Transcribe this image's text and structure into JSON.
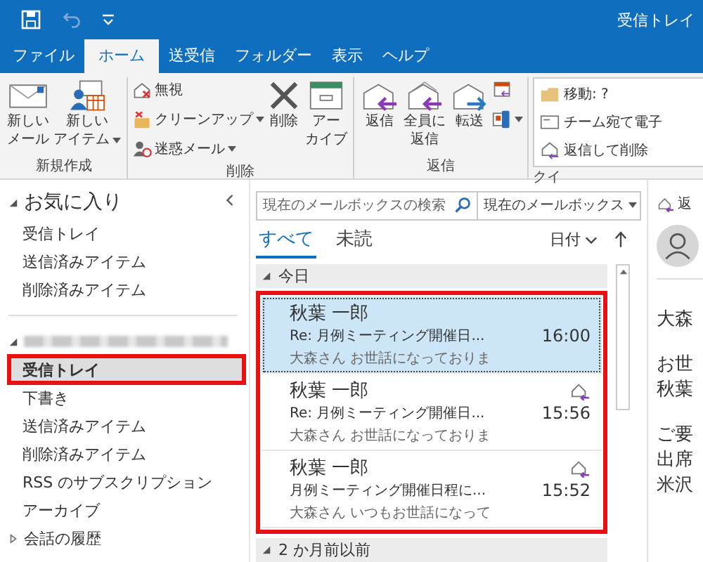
{
  "title_bar": {
    "title": "受信トレイ"
  },
  "ribbon_tabs": [
    {
      "label": "ファイル",
      "selected": false
    },
    {
      "label": "ホーム",
      "selected": true
    },
    {
      "label": "送受信",
      "selected": false
    },
    {
      "label": "フォルダー",
      "selected": false
    },
    {
      "label": "表示",
      "selected": false
    },
    {
      "label": "ヘルプ",
      "selected": false
    }
  ],
  "ribbon_groups": [
    {
      "label": "新規作成",
      "items": [
        {
          "kind": "large",
          "lines": [
            "新しい",
            "メール"
          ],
          "dropdown": false
        },
        {
          "kind": "large",
          "lines": [
            "新しい",
            "アイテム"
          ],
          "dropdown": true
        }
      ]
    },
    {
      "label": "削除",
      "items": [
        {
          "kind": "stack",
          "entries": [
            {
              "label": "無視",
              "dropdown": false
            },
            {
              "label": "クリーンアップ",
              "dropdown": true
            },
            {
              "label": "迷惑メール",
              "dropdown": true
            }
          ]
        },
        {
          "kind": "large",
          "lines": [
            "削除"
          ],
          "dropdown": false
        },
        {
          "kind": "large",
          "lines": [
            "アー",
            "カイブ"
          ],
          "dropdown": false
        }
      ]
    },
    {
      "label": "返信",
      "items": [
        {
          "kind": "large",
          "lines": [
            "返信"
          ],
          "dropdown": false
        },
        {
          "kind": "large",
          "lines": [
            "全員に",
            "返信"
          ],
          "dropdown": false
        },
        {
          "kind": "large",
          "lines": [
            "転送"
          ],
          "dropdown": false
        },
        {
          "kind": "icons",
          "entries": [
            {
              "dropdown": false
            },
            {
              "dropdown": true
            }
          ]
        }
      ]
    },
    {
      "label": "クイ",
      "items": [
        {
          "kind": "quick",
          "entries": [
            {
              "label": "移動: ?"
            },
            {
              "label": "チーム宛て電子"
            },
            {
              "label": "返信して削除"
            }
          ]
        }
      ]
    }
  ],
  "folder_pane": {
    "sections": [
      {
        "kind": "title",
        "label": "お気に入り",
        "expanded": true,
        "items": [
          {
            "label": "受信トレイ",
            "selected": false,
            "highlighted": false
          },
          {
            "label": "送信済みアイテム",
            "selected": false,
            "highlighted": false
          },
          {
            "label": "削除済みアイテム",
            "selected": false,
            "highlighted": false
          }
        ]
      },
      {
        "kind": "account",
        "expanded": true,
        "items": [
          {
            "label": "受信トレイ",
            "selected": true,
            "highlighted": true
          },
          {
            "label": "下書き",
            "selected": false,
            "highlighted": false
          },
          {
            "label": "送信済みアイテム",
            "selected": false,
            "highlighted": false
          },
          {
            "label": "削除済みアイテム",
            "selected": false,
            "highlighted": false
          },
          {
            "label": "RSS のサブスクリプション",
            "selected": false,
            "highlighted": false
          },
          {
            "label": "アーカイブ",
            "selected": false,
            "highlighted": false
          }
        ]
      },
      {
        "kind": "folder",
        "label": "会話の履歴",
        "expanded": false
      }
    ]
  },
  "search": {
    "placeholder": "現在のメールボックスの検索",
    "scope": "現在のメールボックス"
  },
  "filters": [
    {
      "label": "すべて",
      "selected": true
    },
    {
      "label": "未読",
      "selected": false
    }
  ],
  "sort": {
    "label": "日付"
  },
  "message_groups": [
    {
      "label": "今日",
      "expanded": true,
      "highlighted": true,
      "messages": [
        {
          "sender": "秋葉 一郎",
          "subject": "Re: 月例ミーティング開催日...",
          "preview": "大森さん  お世話になっておりま",
          "time": "16:00",
          "selected": true,
          "replied": false
        },
        {
          "sender": "秋葉 一郎",
          "subject": "Re: 月例ミーティング開催日...",
          "preview": "大森さん  お世話になっておりま",
          "time": "15:56",
          "selected": false,
          "replied": true
        },
        {
          "sender": "秋葉 一郎",
          "subject": "月例ミーティング開催日程に...",
          "preview": "大森さん  いつもお世話になって",
          "time": "15:52",
          "selected": false,
          "replied": true
        }
      ]
    },
    {
      "label": "2 か月前以前",
      "expanded": true
    }
  ],
  "reading_pane": {
    "action": "返",
    "paragraphs": [
      [
        "大森"
      ],
      [
        "お世",
        "秋葉"
      ],
      [
        "ご要",
        "出席",
        "米沢"
      ]
    ]
  }
}
